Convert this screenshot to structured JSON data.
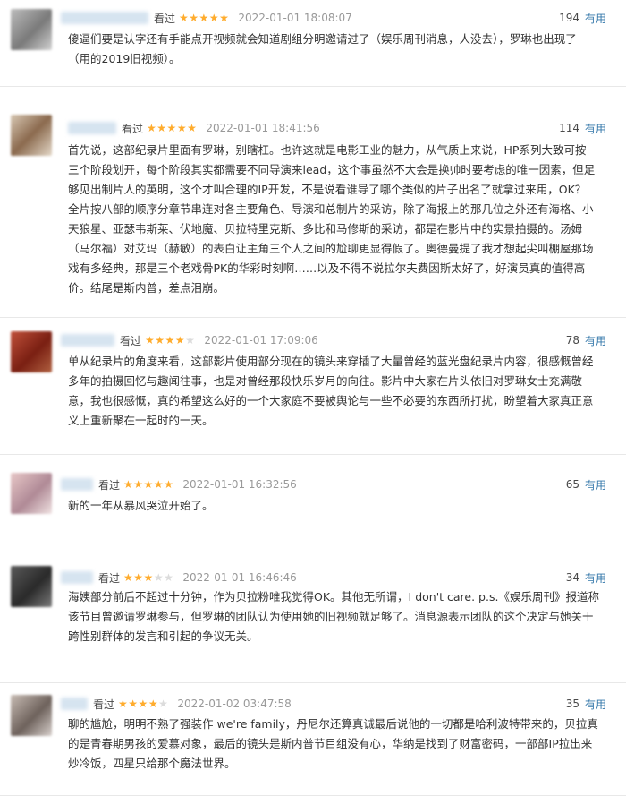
{
  "reviews": [
    {
      "status": "看过",
      "rating": 5,
      "time": "2022-01-01 18:08:07",
      "votes": "194",
      "vote_label": "有用",
      "lines": [
        "傻逼们要是认字还有手能点开视频就会知道剧组分明邀请过了（娱乐周刊消息，人没去），罗琳也出现了",
        "（用的2019旧视频）。"
      ]
    },
    {
      "status": "看过",
      "rating": 5,
      "time": "2022-01-01 18:41:56",
      "votes": "114",
      "vote_label": "有用",
      "lines": [
        "首先说，这部纪录片里面有罗琳，别瞎杠。也许这就是电影工业的魅力，从气质上来说，HP系列大致可按",
        "三个阶段划开，每个阶段其实都需要不同导演来lead，这个事虽然不大会是换帅时要考虑的唯一因素，但足",
        "够见出制片人的英明，这个才叫合理的IP开发，不是说看谁导了哪个类似的片子出名了就拿过来用，OK？",
        "全片按八部的顺序分章节串连对各主要角色、导演和总制片的采访，除了海报上的那几位之外还有海格、小",
        "天狼星、亚瑟韦斯莱、伏地魔、贝拉特里克斯、多比和马修斯的采访，都是在影片中的实景拍摄的。汤姆",
        "（马尔福）对艾玛（赫敏）的表白让主角三个人之间的尬聊更显得假了。奥德曼提了我才想起尖叫棚屋那场",
        "戏有多经典，那是三个老戏骨PK的华彩时刻啊……以及不得不说拉尔夫费因斯太好了，好演员真的值得高",
        "价。结尾是斯内普，差点泪崩。"
      ]
    },
    {
      "status": "看过",
      "rating": 4,
      "time": "2022-01-01 17:09:06",
      "votes": "78",
      "vote_label": "有用",
      "lines": [
        "单从纪录片的角度来看，这部影片使用部分现在的镜头来穿插了大量曾经的蓝光盘纪录片内容，很感慨曾经",
        "多年的拍摄回忆与趣闻往事，也是对曾经那段快乐岁月的向往。影片中大家在片头依旧对罗琳女士充满敬",
        "意，我也很感慨，真的希望这么好的一个大家庭不要被舆论与一些不必要的东西所打扰，盼望着大家真正意",
        "义上重新聚在一起时的一天。"
      ]
    },
    {
      "status": "看过",
      "rating": 5,
      "time": "2022-01-01 16:32:56",
      "votes": "65",
      "vote_label": "有用",
      "lines": [
        "新的一年从暴风哭泣开始了。"
      ]
    },
    {
      "status": "看过",
      "rating": 3,
      "time": "2022-01-01 16:46:46",
      "votes": "34",
      "vote_label": "有用",
      "lines": [
        "海姨部分前后不超过十分钟，作为贝拉粉唯我觉得OK。其他无所谓，I don't care. p.s.《娱乐周刊》报道称",
        "该节目曾邀请罗琳参与，但罗琳的团队认为使用她的旧视频就足够了。消息源表示团队的这个决定与她关于",
        "跨性别群体的发言和引起的争议无关。"
      ]
    },
    {
      "status": "看过",
      "rating": 4,
      "time": "2022-01-02 03:47:58",
      "votes": "35",
      "vote_label": "有用",
      "lines": [
        "聊的尴尬，明明不熟了强装作 we're family，丹尼尔还算真诚最后说他的一切都是哈利波特带来的，贝拉真",
        "的是青春期男孩的爱慕对象，最后的镜头是斯内普节目组没有心，华纳是找到了财富密码，一部部IP拉出来",
        "炒冷饭，四星只给那个魔法世界。"
      ]
    }
  ],
  "colors": {
    "star_on": "#ffac2d",
    "star_off": "#dcdcdc",
    "vote_label": "#37a",
    "time": "#999999"
  }
}
